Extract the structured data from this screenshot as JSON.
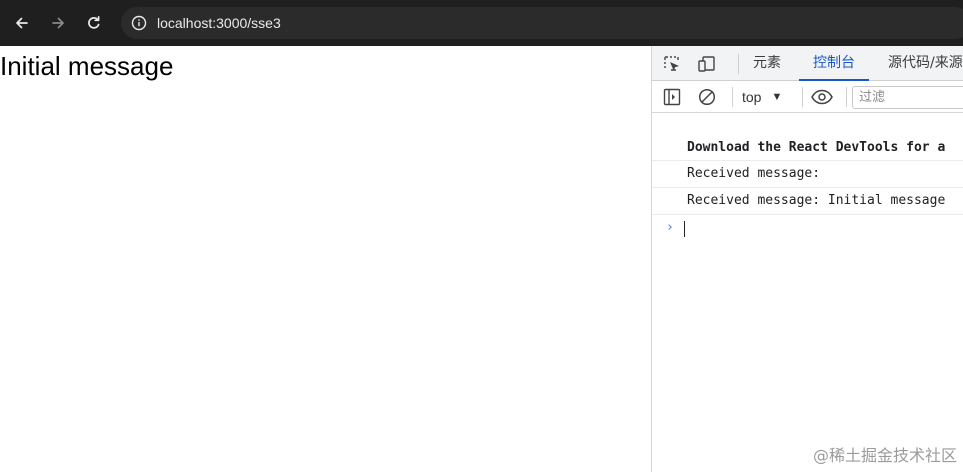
{
  "browser": {
    "url": "localhost:3000/sse3",
    "icons": {
      "back": "arrow-left-icon",
      "forward": "arrow-right-icon",
      "reload": "reload-icon",
      "site_info": "info-icon"
    }
  },
  "page": {
    "text": "Initial message"
  },
  "devtools": {
    "tabs": [
      {
        "label": "元素",
        "active": false
      },
      {
        "label": "控制台",
        "active": true
      },
      {
        "label": "源代码/来源",
        "active": false
      }
    ],
    "toolbar": {
      "context": "top",
      "filter_placeholder": "过滤"
    },
    "console_lines": [
      {
        "text": "Download the React DevTools for a",
        "bold": true
      },
      {
        "text": "Received message:",
        "bold": false
      },
      {
        "text": "Received message: Initial message",
        "bold": false
      }
    ],
    "prompt_symbol": "›"
  },
  "watermark": "@稀土掘金技术社区",
  "colors": {
    "toolbar_bg": "#1f1f1f",
    "omnibox_bg": "#2b2b2b",
    "active_tab": "#1a56c9",
    "prompt": "#3b7bd8"
  }
}
